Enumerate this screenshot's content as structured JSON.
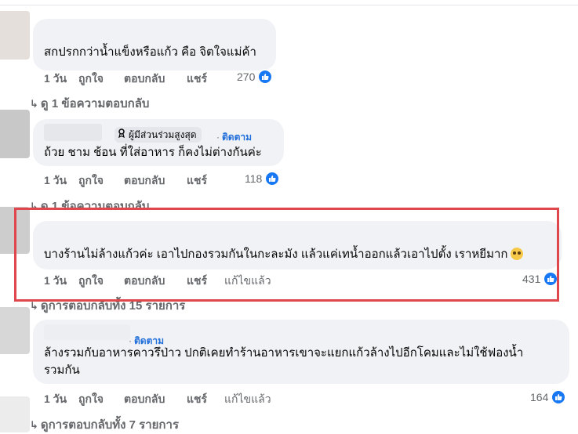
{
  "comments": [
    {
      "text": "สกปรกกว่าน้ำแข็งหรือแก้ว คือ จิตใจแม่ค้า",
      "time": "1 วัน",
      "like": "ถูกใจ",
      "reply": "ตอบกลับ",
      "share": "แชร์",
      "likes": "270",
      "replies_link": "ดู 1 ข้อความตอบกลับ"
    },
    {
      "badge": "ผู้มีส่วนร่วมสูงสุด",
      "follow": "ติดตาม",
      "text": "ถ้วย ชาม ช้อน ที่ใส่อาหาร ก็คงไม่ต่างกันค่ะ",
      "time": "1 วัน",
      "like": "ถูกใจ",
      "reply": "ตอบกลับ",
      "share": "แชร์",
      "likes": "118",
      "replies_link": "ดู 1 ข้อความตอบกลับ"
    },
    {
      "text": "บางร้านไม่ล้างแก้วค่ะ เอาไปกองรวมกันในกะละมัง แล้วแค่เทน้ำออกแล้วเอาไปตั้ง เราหยีมาก",
      "time": "1 วัน",
      "like": "ถูกใจ",
      "reply": "ตอบกลับ",
      "share": "แชร์",
      "edited": "แก้ไขแล้ว",
      "likes": "431",
      "replies_link": "ดูการตอบกลับทั้ง 15 รายการ"
    },
    {
      "follow": "ติดตาม",
      "text_line1": "ล้างรวมกับอาหารคาวรึป่าว ปกติเคยทำร้านอาหารเขาจะแยกแก้วล้างไปอีกโคมและไม่ใช้ฟองน้ำ",
      "text_line2": "รวมกัน",
      "time": "1 วัน",
      "like": "ถูกใจ",
      "reply": "ตอบกลับ",
      "share": "แชร์",
      "edited": "แก้ไขแล้ว",
      "likes": "164",
      "replies_link": "ดูการตอบกลับทั้ง 7 รายการ"
    }
  ],
  "colors": {
    "accent": "#1877f2",
    "highlight": "#e0474c",
    "bubble": "#f0f2f5"
  },
  "icons": {
    "like": "thumbs-up-icon",
    "badge": "top-contributor-icon",
    "emoji": "disgust-emoji-icon"
  }
}
